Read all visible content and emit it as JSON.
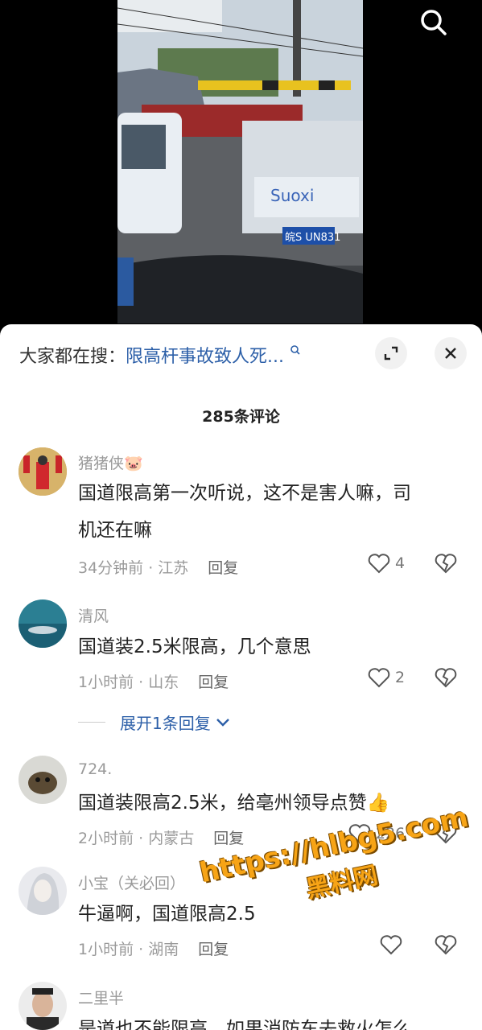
{
  "search_bar": {
    "prefix": "大家都在搜：",
    "query": "限高杆事故致人死..."
  },
  "comments_header": {
    "count_label": "285条评论"
  },
  "comments": [
    {
      "user": "猪猪侠🐷",
      "text_line1": "国道限高第一次听说，这不是害人嘛，司",
      "text_line2": "机还在嘛",
      "time": "34分钟前 · 江苏",
      "reply": "回复",
      "likes": "4"
    },
    {
      "user": "清风",
      "text": "国道装2.5米限高，几个意思",
      "time": "1小时前 · 山东",
      "reply": "回复",
      "likes": "2",
      "expand": "展开1条回复"
    },
    {
      "user": "724.",
      "text": "国道装限高2.5米，给亳州领导点赞👍",
      "time": "2小时前 · 内蒙古",
      "reply": "回复",
      "likes": "226"
    },
    {
      "user": "小宝（关必回）",
      "text": "牛逼啊，国道限高2.5",
      "time": "1小时前 · 湖南",
      "reply": "回复",
      "likes": ""
    },
    {
      "user": "二里半",
      "text": "是道也不能限高，如果消防车去救火怎么"
    }
  ],
  "watermark": {
    "url": "https://hlbg5.com",
    "name": "黑料网"
  },
  "video": {
    "plate": "皖S UN831",
    "truck_text": "Suoxi"
  },
  "colors": {
    "link": "#2c5fa8",
    "watermark": "#f7a416"
  }
}
